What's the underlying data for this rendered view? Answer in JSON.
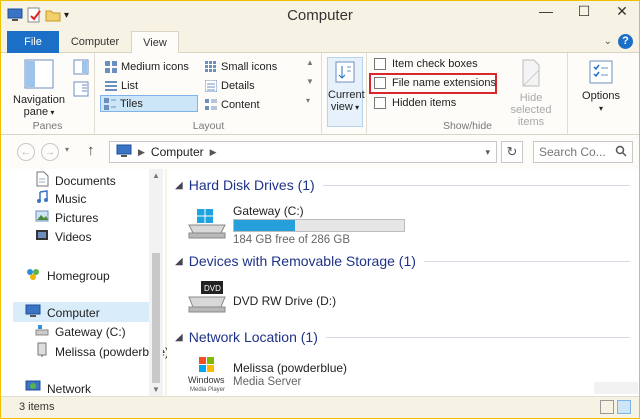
{
  "window": {
    "title": "Computer"
  },
  "tabs": {
    "file": "File",
    "computer": "Computer",
    "view": "View"
  },
  "ribbon": {
    "panes": {
      "navigation_pane": "Navigation",
      "navigation_pane_2": "pane",
      "label": "Panes"
    },
    "layout": {
      "items": [
        "Medium icons",
        "Small icons",
        "List",
        "Details",
        "Tiles",
        "Content"
      ],
      "selected": "Tiles",
      "label": "Layout"
    },
    "current_view": {
      "line1": "Current",
      "line2": "view"
    },
    "show_hide": {
      "item_check_boxes": "Item check boxes",
      "file_name_extensions": "File name extensions",
      "hidden_items": "Hidden items",
      "hide_selected_1": "Hide selected",
      "hide_selected_2": "items",
      "label": "Show/hide"
    },
    "options": "Options"
  },
  "address": {
    "path": "Computer",
    "search_placeholder": "Search Co..."
  },
  "nav": {
    "items": [
      "Documents",
      "Music",
      "Pictures",
      "Videos",
      "Homegroup",
      "Computer",
      "Gateway (C:)",
      "Melissa (powderblue)",
      "Network"
    ],
    "selected": "Computer"
  },
  "content": {
    "sections": [
      {
        "title": "Hard Disk Drives (1)"
      },
      {
        "title": "Devices with Removable Storage (1)"
      },
      {
        "title": "Network Location (1)"
      }
    ],
    "drive_c": {
      "name": "Gateway (C:)",
      "free_text": "184 GB free of 286 GB",
      "used_fraction": 0.357
    },
    "dvd": {
      "name": "DVD RW Drive (D:)",
      "icon_text": "DVD"
    },
    "network": {
      "name": "Melissa (powderblue)",
      "sub": "Media Server",
      "logo_text": "Windows",
      "logo_sub": "Media Player"
    }
  },
  "status": {
    "count": "3 items"
  },
  "colors": {
    "accent": "#1c6fc6",
    "highlight_box": "#d9262b",
    "progress": "#26a0da"
  }
}
